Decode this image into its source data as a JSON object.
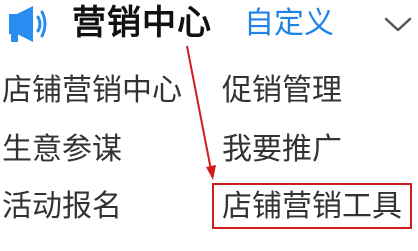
{
  "header": {
    "icon": "megaphone-icon",
    "title": "营销中心",
    "customize_label": "自定义",
    "expand_icon": "chevron-down-icon"
  },
  "menu": {
    "left": [
      "店铺营销中心",
      "生意参谋",
      "活动报名"
    ],
    "right": [
      "促销管理",
      "我要推广",
      "店铺营销工具"
    ]
  },
  "colors": {
    "accent": "#1e82e6",
    "icon": "#2a8cf0",
    "annotation": "#d11d1d"
  }
}
